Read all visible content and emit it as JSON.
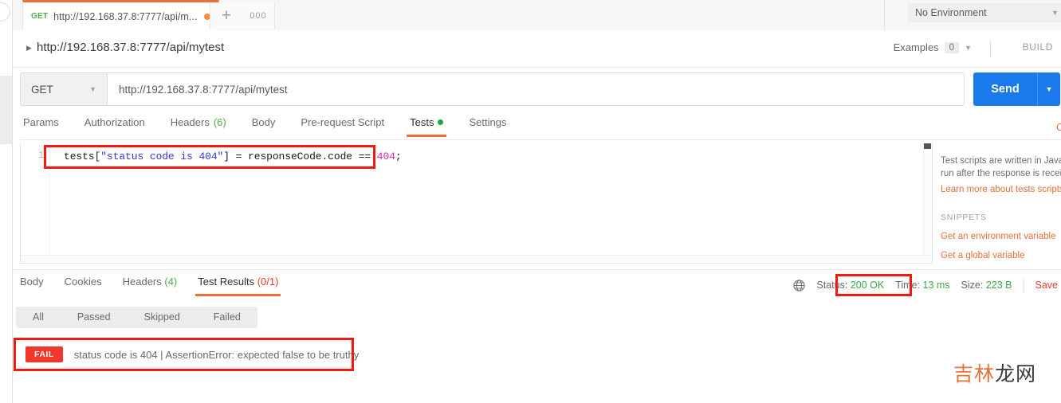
{
  "tabstrip": {
    "request_tab": {
      "method": "GET",
      "name": "http://192.168.37.8:7777/api/m...",
      "unsaved_icon": "unsaved-dot"
    },
    "new_tab_icon": "plus-icon",
    "more_tabs_icon": "ellipsis-icon",
    "environment": {
      "selected": "No Environment",
      "caret_icon": "chevron-down-icon"
    }
  },
  "breadcrumb": {
    "expand_icon": "triangle-right-icon",
    "title": "http://192.168.37.8:7777/api/mytest",
    "examples_label": "Examples",
    "examples_count": "0",
    "examples_caret_icon": "chevron-down-icon",
    "build_label": "BUILD"
  },
  "url_bar": {
    "method": "GET",
    "method_caret_icon": "chevron-down-icon",
    "url": "http://192.168.37.8:7777/api/mytest",
    "send_label": "Send",
    "send_caret_icon": "chevron-down-icon"
  },
  "request_tabs": [
    {
      "label": "Params",
      "count": "",
      "active": false
    },
    {
      "label": "Authorization",
      "count": "",
      "active": false
    },
    {
      "label": "Headers",
      "count": "(6)",
      "active": false
    },
    {
      "label": "Body",
      "count": "",
      "active": false
    },
    {
      "label": "Pre-request Script",
      "count": "",
      "active": false
    },
    {
      "label": "Tests",
      "count": "",
      "active": true
    },
    {
      "label": "Settings",
      "count": "",
      "active": false
    }
  ],
  "editor": {
    "line_number": "1",
    "code": {
      "t1": "tests[",
      "t2": "\"status code is 404\"",
      "t3": "] = responseCode.code == ",
      "t4": "404",
      "t5": ";"
    }
  },
  "doc_panel": {
    "line1": "Test scripts are written in JavaScr",
    "line2": "run after the response is receive",
    "learn_link": "Learn more about tests scripts",
    "snippets_heading": "SNIPPETS",
    "snippet1": "Get an environment variable",
    "snippet2": "Get a global variable",
    "cookies_sliver": "C"
  },
  "response_tabs": [
    {
      "label": "Body",
      "count": "",
      "active": false
    },
    {
      "label": "Cookies",
      "count": "",
      "active": false
    },
    {
      "label": "Headers",
      "count": "(4)",
      "active": false
    },
    {
      "label": "Test Results",
      "count": "(0/1)",
      "active": true
    }
  ],
  "status_bar": {
    "globe_icon": "globe-icon",
    "status_label": "Status:",
    "status_value": "200 OK",
    "time_label": "Time:",
    "time_value": "13 ms",
    "size_label": "Size:",
    "size_value": "223 B",
    "save_label": "Save"
  },
  "result_filters": [
    {
      "label": "All"
    },
    {
      "label": "Passed"
    },
    {
      "label": "Skipped"
    },
    {
      "label": "Failed"
    }
  ],
  "test_results": [
    {
      "badge": "FAIL",
      "text": "status code is 404 | AssertionError: expected false to be truthy"
    }
  ],
  "watermark": {
    "part_a": "吉林",
    "part_b": "龙网"
  },
  "colors": {
    "accent_orange": "#e8703a",
    "send_blue": "#1a7aec",
    "fail_red": "#f0372b",
    "highlight_red": "#f01a0d",
    "success_green": "#4caf50",
    "string_blue": "#3b36d6",
    "number_pink": "#d62aa8"
  }
}
